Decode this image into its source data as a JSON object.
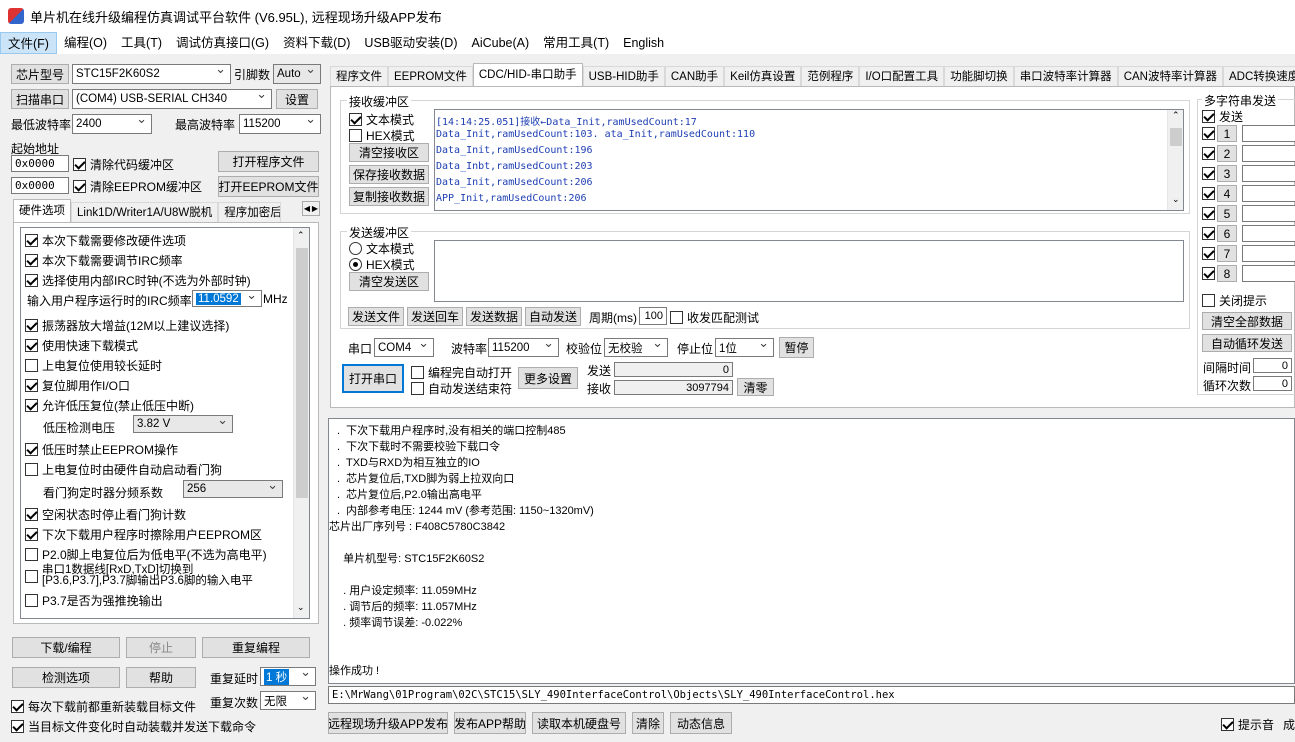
{
  "title": "单片机在线升级编程仿真调试平台软件 (V6.95L), 远程现场升级APP发布",
  "menu": [
    "文件(F)",
    "编程(O)",
    "工具(T)",
    "调试仿真接口(G)",
    "资料下载(D)",
    "USB驱动安装(D)",
    "AiCube(A)",
    "常用工具(T)",
    "English"
  ],
  "left": {
    "chip_btn": "芯片型号",
    "chip_value": "STC15F2K60S2",
    "pin_label": "引脚数",
    "pin_value": "Auto",
    "scan_btn": "扫描串口",
    "port_value": "(COM4) USB-SERIAL CH340",
    "settings_btn": "设置",
    "min_baud_label": "最低波特率",
    "min_baud": "2400",
    "max_baud_label": "最高波特率",
    "max_baud": "115200",
    "start_addr_label": "起始地址",
    "addr1": "0x0000",
    "clear_code": "清除代码缓冲区",
    "open_prog": "打开程序文件",
    "addr2": "0x0000",
    "clear_eeprom": "清除EEPROM缓冲区",
    "open_eeprom": "打开EEPROM文件",
    "tabs": [
      "硬件选项",
      "Link1D/Writer1A/U8W脱机",
      "程序加密后"
    ],
    "hw": {
      "opt1": "本次下载需要修改硬件选项",
      "opt2": "本次下载需要调节IRC频率",
      "opt3": "选择使用内部IRC时钟(不选为外部时钟)",
      "irc_label": "输入用户程序运行时的IRC频率",
      "irc_value": "11.0592",
      "irc_unit": "MHz",
      "opt4": "振荡器放大增益(12M以上建议选择)",
      "opt5": "使用快速下载模式",
      "opt6": "上电复位使用较长延时",
      "opt7": "复位脚用作I/O口",
      "opt8": "允许低压复位(禁止低压中断)",
      "lv_label": "低压检测电压",
      "lv_value": "3.82 V",
      "opt9": "低压时禁止EEPROM操作",
      "opt10": "上电复位时由硬件自动启动看门狗",
      "wdt_label": "看门狗定时器分频系数",
      "wdt_value": "256",
      "opt11": "空闲状态时停止看门狗计数",
      "opt12": "下次下载用户程序时擦除用户EEPROM区",
      "opt13": "P2.0脚上电复位后为低电平(不选为高电平)",
      "opt14a": "串口1数据线[RxD,TxD]切换到",
      "opt14b": "[P3.6,P3.7],P3.7脚输出P3.6脚的输入电平",
      "opt15": "P3.7是否为强推挽输出"
    },
    "download_btn": "下载/编程",
    "stop_btn": "停止",
    "reprog_btn": "重复编程",
    "detect_btn": "检测选项",
    "help_btn": "帮助",
    "repeat_delay_label": "重复延时",
    "repeat_delay": "1 秒",
    "repeat_count_label": "重复次数",
    "repeat_count": "无限",
    "reload_each": "每次下载前都重新装载目标文件",
    "auto_reload": "当目标文件变化时自动装载并发送下载命令"
  },
  "main_tabs": [
    "程序文件",
    "EEPROM文件",
    "CDC/HID-串口助手",
    "USB-HID助手",
    "CAN助手",
    "Keil仿真设置",
    "范例程序",
    "I/O口配置工具",
    "功能脚切换",
    "串口波特率计算器",
    "CAN波特率计算器",
    "ADC转换速度计"
  ],
  "recv": {
    "title": "接收缓冲区",
    "text_mode": "文本模式",
    "hex_mode": "HEX模式",
    "clear": "清空接收区",
    "save": "保存接收数据",
    "copy": "复制接收数据",
    "lines": [
      "[14:14:25.051]接收←Data_Init,ramUsedCount:17",
      "                   Data_Init,ramUsedCount:103.   ata_Init,ramUsedCount:110",
      "                   Data_Init,ramUsedCount:196",
      "                   Data_Inbt,ramUsedCount:203",
      "                   Data_Init,ramUsedCount:206",
      "                   APP_Init,ramUsedCount:206"
    ]
  },
  "send": {
    "title": "发送缓冲区",
    "text_mode": "文本模式",
    "hex_mode": "HEX模式",
    "clear": "清空发送区",
    "send_file": "发送文件",
    "send_enter": "发送回车",
    "send_data": "发送数据",
    "auto_send": "自动发送",
    "period_label": "周期(ms)",
    "period": "100",
    "match_test": "收发匹配测试"
  },
  "port": {
    "port_label": "串口",
    "port_value": "COM4",
    "baud_label": "波特率",
    "baud_value": "115200",
    "parity_label": "校验位",
    "parity_value": "无校验",
    "stop_label": "停止位",
    "stop_value": "1位",
    "pause": "暂停",
    "open": "打开串口",
    "auto_open": "编程完自动打开",
    "auto_end": "自动发送结束符",
    "more": "更多设置",
    "sent_label": "发送",
    "sent_value": "0",
    "recv_label": "接收",
    "recv_value": "3097794",
    "clear": "清零"
  },
  "multi": {
    "title": "多字符串发送",
    "send_label": "发送",
    "items": [
      "1",
      "2",
      "3",
      "4",
      "5",
      "6",
      "7",
      "8"
    ],
    "close_tip": "关闭提示",
    "clear_all": "清空全部数据",
    "auto_loop": "自动循环发送",
    "interval_label": "间隔时间",
    "interval": "0",
    "loop_label": "循环次数",
    "loop": "0"
  },
  "log": [
    ".  下次下载用户程序时,没有相关的端口控制485",
    ".  下次下载时不需要校验下载口令",
    ".  TXD与RXD为相互独立的IO",
    ".  芯片复位后,TXD脚为弱上拉双向口",
    ".  芯片复位后,P2.0输出高电平",
    ".  内部参考电压: 1244 mV (参考范围: 1150~1320mV)",
    "芯片出厂序列号 : F408C5780C3842",
    "",
    "  单片机型号: STC15F2K60S2",
    "",
    "  . 用户设定频率: 11.059MHz",
    "  . 调节后的频率: 11.057MHz",
    "  . 频率调节误差: -0.022%",
    "",
    "",
    "操作成功 !"
  ],
  "file_path": "E:\\MrWang\\01Program\\02C\\STC15\\SLY_490InterfaceControl\\Objects\\SLY_490InterfaceControl.hex",
  "bottom": {
    "remote": "远程现场升级APP发布",
    "publish_help": "发布APP帮助",
    "read_disk": "读取本机硬盘号",
    "clear": "清除",
    "dynamic": "动态信息",
    "sound": "提示音",
    "tail": "成"
  }
}
